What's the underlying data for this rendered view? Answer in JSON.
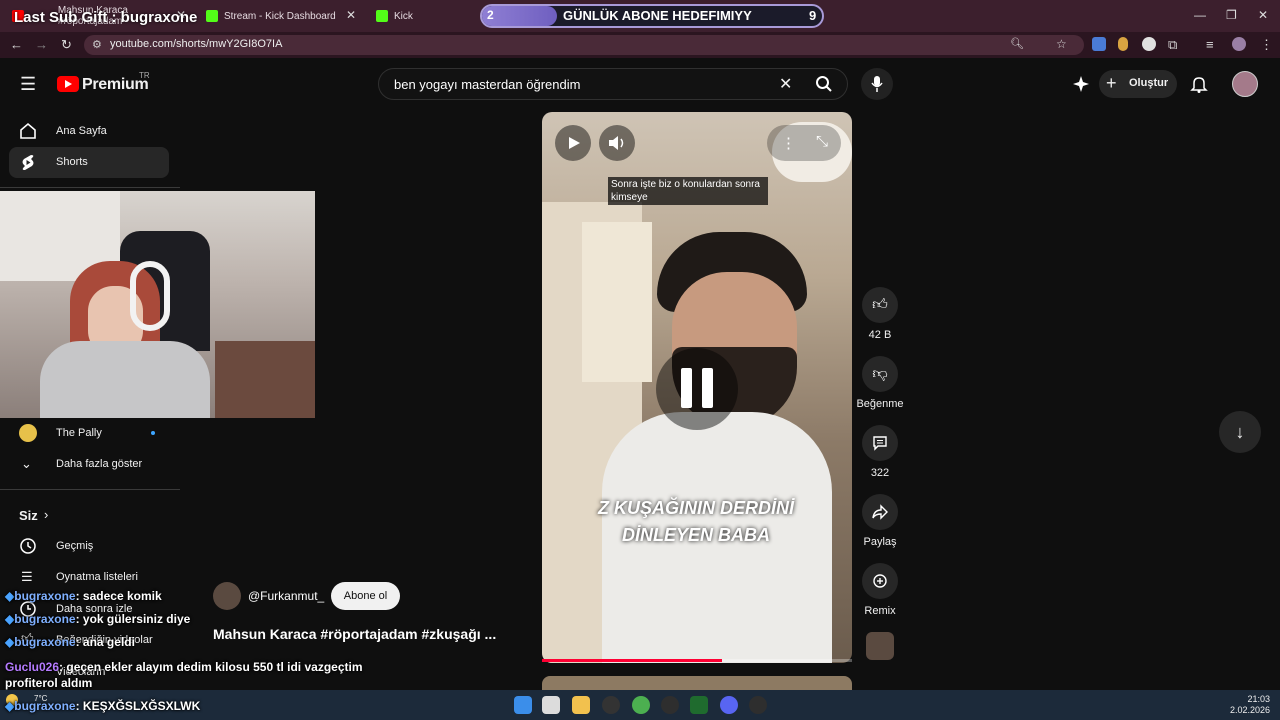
{
  "browser": {
    "tabs": [
      {
        "label": "Mahsun Karaca #röportajadam",
        "color": "#ff0000"
      },
      {
        "label": "Stream - Kick Dashboard",
        "color": "#53fc18"
      },
      {
        "label": "Kick",
        "color": "#53fc18"
      }
    ],
    "url": "youtube.com/shorts/mwY2GI8O7IA"
  },
  "stream_overlay": {
    "last_sub": "Last Sub Gift : bugraxone",
    "goal": {
      "current": "2",
      "label": "GÜNLÜK ABONE HEDEFIMIYY",
      "target": "9",
      "progress": 0.22
    }
  },
  "header": {
    "brand": "Premium",
    "brand_sup": "TR",
    "search_value": "ben yogayı masterdan öğrendim",
    "create_label": "Oluştur"
  },
  "sidebar": {
    "home": "Ana Sayfa",
    "shorts": "Shorts",
    "sub_channel": "The Pally",
    "show_more": "Daha fazla göster",
    "you": "Siz",
    "history": "Geçmiş",
    "playlists": "Oynatma listeleri",
    "watch_later": "Daha sonra izle",
    "liked": "Beğendiğin videolar",
    "videos": "Videoların"
  },
  "short": {
    "caption": "Sonra işte biz o konulardan sonra kimseye",
    "overlay_line1": "Z KUŞAĞININ DERDİNİ",
    "overlay_line2": "DİNLEYEN BABA",
    "progress": 0.58,
    "channel": "@Furkanmut_",
    "subscribe": "Abone ol",
    "title": "Mahsun Karaca #röportajadam #zkuşağı ..."
  },
  "actions": {
    "likes": "42 B",
    "dislike": "Beğenme",
    "comments": "322",
    "share": "Paylaş",
    "remix": "Remix"
  },
  "chat": [
    {
      "user": "bugraxone",
      "msg": "sadece komik"
    },
    {
      "user": "bugraxone",
      "msg": "yok gülersiniz diye"
    },
    {
      "user": "bugraxone",
      "msg": "ana geldi"
    },
    {
      "user": "Guclu026",
      "msg": "geçen ekler alayım dedim kilosu 550 tl idi vazgeçtim profiterol aldım"
    },
    {
      "user": "bugraxone",
      "msg": "KEŞXĞSLXĞSXLWK"
    }
  ],
  "taskbar": {
    "weather": "7°C",
    "time": "21:03",
    "date": "2.02.2026"
  }
}
